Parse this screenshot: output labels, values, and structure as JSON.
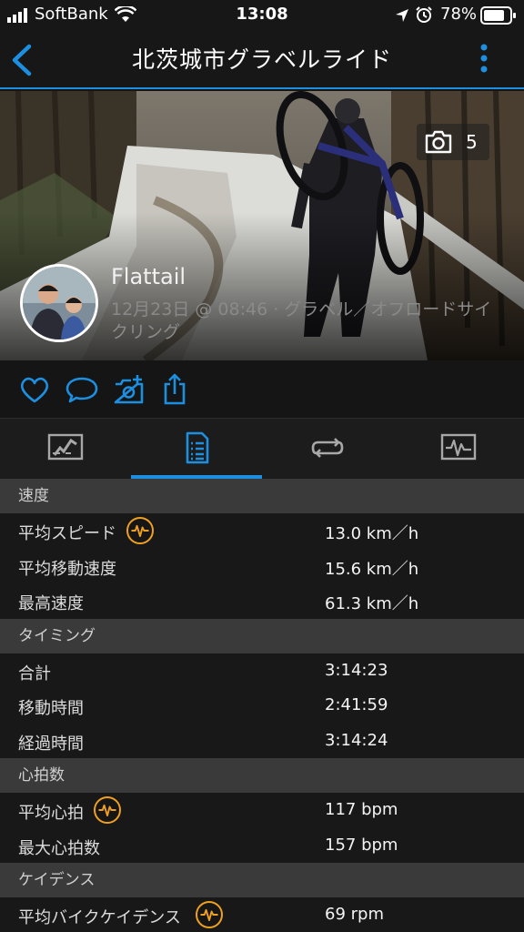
{
  "status_bar": {
    "carrier": "SoftBank",
    "time": "13:08",
    "battery": "78%"
  },
  "nav": {
    "title": "北茨城市グラベルライド",
    "back_icon": "chevron-left-icon",
    "more_icon": "vertical-ellipsis-icon"
  },
  "hero": {
    "photo_count": "5",
    "user_name": "Flattail",
    "activity_meta": "12月23日 @ 08:46 · グラベル／オフロードサイクリング"
  },
  "actions": [
    "heart-icon",
    "comment-icon",
    "add-photo-icon",
    "share-icon"
  ],
  "tabs": [
    {
      "icon": "map-summary-icon",
      "active": false
    },
    {
      "icon": "stats-list-icon",
      "active": true
    },
    {
      "icon": "laps-icon",
      "active": false
    },
    {
      "icon": "charts-icon",
      "active": false
    }
  ],
  "sections": [
    {
      "title": "速度",
      "rows": [
        {
          "label": "平均スピード",
          "value": "13.0 km／h",
          "badge": true
        },
        {
          "label": "平均移動速度",
          "value": "15.6 km／h",
          "badge": false
        },
        {
          "label": "最高速度",
          "value": "61.3 km／h",
          "badge": false
        }
      ]
    },
    {
      "title": "タイミング",
      "rows": [
        {
          "label": "合計",
          "value": "3:14:23",
          "badge": false
        },
        {
          "label": "移動時間",
          "value": "2:41:59",
          "badge": false
        },
        {
          "label": "経過時間",
          "value": "3:14:24",
          "badge": false
        }
      ]
    },
    {
      "title": "心拍数",
      "rows": [
        {
          "label": "平均心拍",
          "value": "117 bpm",
          "badge": true
        },
        {
          "label": "最大心拍数",
          "value": "157 bpm",
          "badge": false
        }
      ]
    },
    {
      "title": "ケイデンス",
      "rows": [
        {
          "label": "平均バイクケイデンス",
          "value": "69 rpm",
          "badge": true
        }
      ]
    }
  ],
  "colors": {
    "accent_blue": "#1d8fe0",
    "badge_orange": "#f0a021",
    "section_header_bg": "#3a3a3a",
    "row_bg": "#181818"
  }
}
